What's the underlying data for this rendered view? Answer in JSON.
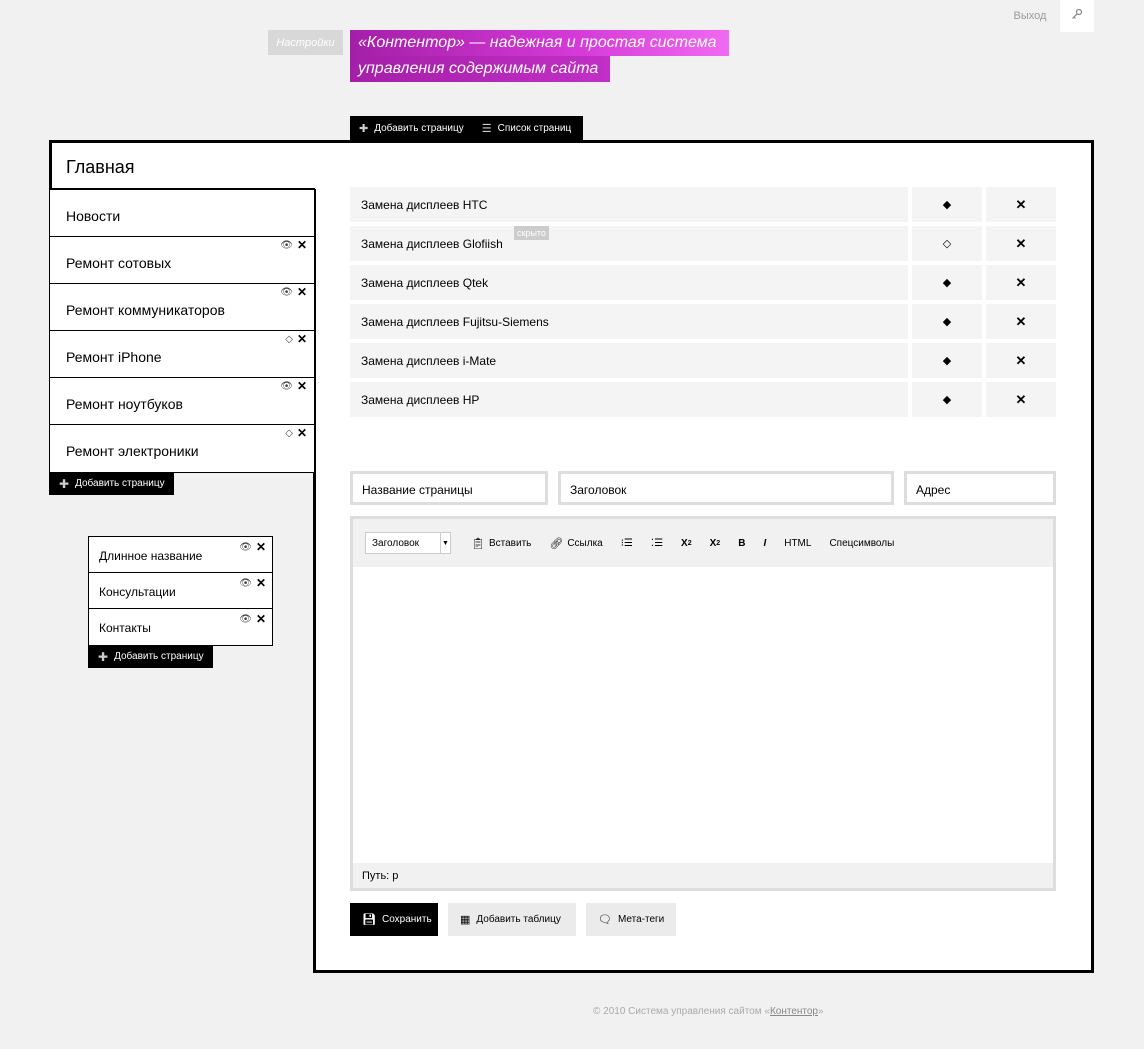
{
  "header": {
    "logout": "Выход",
    "settings_tab": "Настройки",
    "slogan_line1": "«Контентор» — надежная и простая система",
    "slogan_line2": "управления содержимым сайта"
  },
  "top_tabs": [
    {
      "label": "Добавить страницу",
      "icon": "plus-icon"
    },
    {
      "label": "Список страниц",
      "icon": "list-icon"
    }
  ],
  "sidebar": {
    "current": "Главная",
    "items": [
      {
        "label": "Новости",
        "icons": false
      },
      {
        "label": "Ремонт сотовых",
        "icons": true
      },
      {
        "label": "Ремонт коммуникаторов",
        "icons": true
      },
      {
        "label": "Ремонт iPhone",
        "icons": true
      },
      {
        "label": "Ремонт ноутбуков",
        "icons": true
      },
      {
        "label": "Ремонт электроники",
        "icons": true
      }
    ],
    "add_label": "Добавить страницу"
  },
  "sidebar2": {
    "items": [
      {
        "label": "Длинное название"
      },
      {
        "label": "Консультации"
      },
      {
        "label": "Контакты"
      }
    ],
    "add_label": "Добавить страницу"
  },
  "subpages": [
    {
      "name": "Замена дисплеев HTC"
    },
    {
      "name": "Замена дисплеев Glofiish",
      "badge": "скрыто"
    },
    {
      "name": "Замена дисплеев Qtek"
    },
    {
      "name": "Замена дисплеев Fujitsu-Siemens"
    },
    {
      "name": "Замена дисплеев i-Mate"
    },
    {
      "name": "Замена дисплеев HP"
    }
  ],
  "form": {
    "page_name": "Название страницы",
    "heading": "Заголовок",
    "url": "Адрес"
  },
  "editor": {
    "format_select": "Заголовок",
    "paste": "Вставить",
    "link": "Ссылка",
    "superscript": "X",
    "subscript": "X",
    "bold": "B",
    "italic": "I",
    "html": "HTML",
    "special": "Спецсимволы",
    "path": "Путь: p"
  },
  "buttons": {
    "save": "Сохранить",
    "add_table": "Добавить таблицу",
    "meta": "Мета-теги"
  },
  "footer": {
    "text": "© 2010 Система управления сайтом «",
    "link": "Контентор",
    "end": "»"
  },
  "colors": {
    "accent": "#c22fc6",
    "frame": "#000000",
    "background": "#f1f1f1"
  }
}
